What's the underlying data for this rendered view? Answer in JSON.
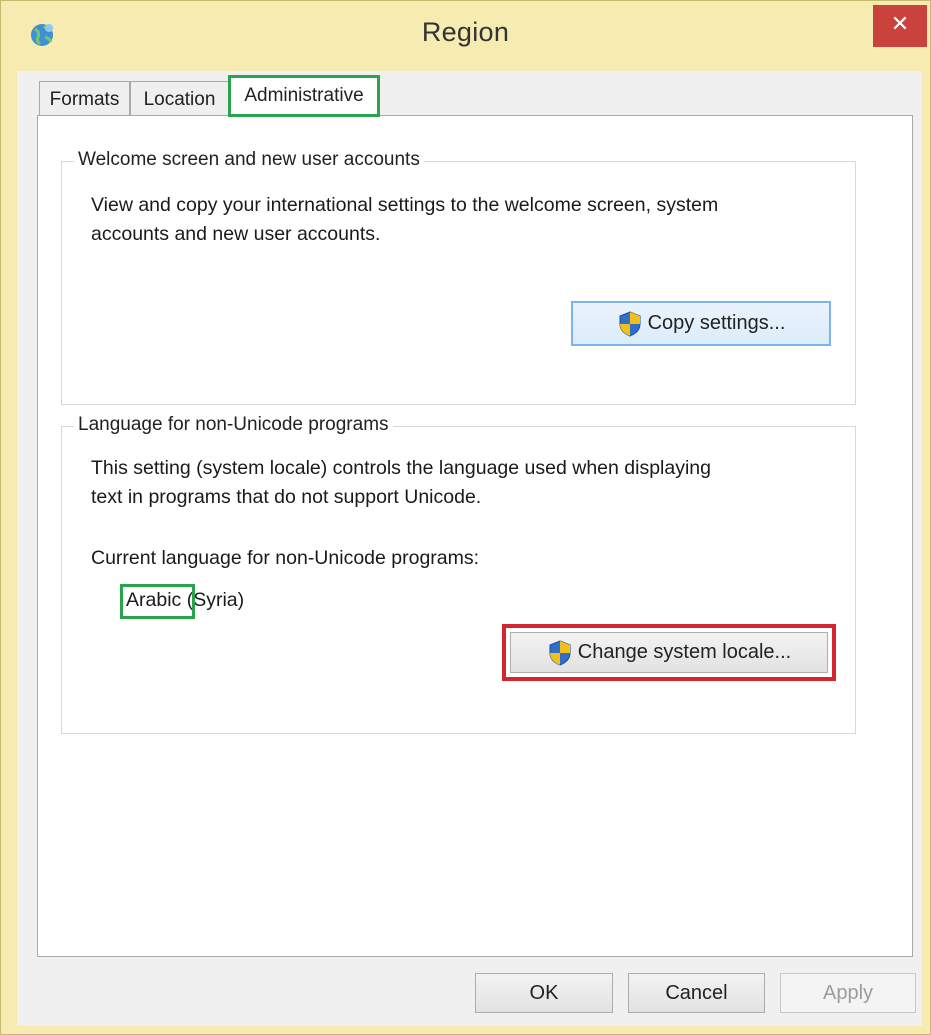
{
  "window": {
    "title": "Region",
    "close_label": "✕",
    "icons": {
      "app": "region-globe-icon",
      "close": "close-icon",
      "shield": "uac-shield-icon"
    }
  },
  "tabs": [
    {
      "label": "Formats",
      "active": false
    },
    {
      "label": "Location",
      "active": false
    },
    {
      "label": "Administrative",
      "active": true
    }
  ],
  "welcome_group": {
    "title": "Welcome screen and new user accounts",
    "description_line1": "View and copy your international settings to the welcome screen, system",
    "description_line2": "accounts and new user accounts.",
    "copy_button": "Copy settings..."
  },
  "locale_group": {
    "title": "Language for non-Unicode programs",
    "description_line1": "This setting (system locale) controls the language used when displaying",
    "description_line2": "text in programs that do not support Unicode.",
    "current_label": "Current language for non-Unicode programs:",
    "current_language": "Arabic",
    "current_region": "(Syria)",
    "change_button": "Change system locale..."
  },
  "footer": {
    "ok": "OK",
    "cancel": "Cancel",
    "apply": "Apply"
  },
  "colors": {
    "frame": "#f6ebb0",
    "close": "#c9433c",
    "highlight_green": "#2ba24c",
    "highlight_red": "#d32630"
  }
}
